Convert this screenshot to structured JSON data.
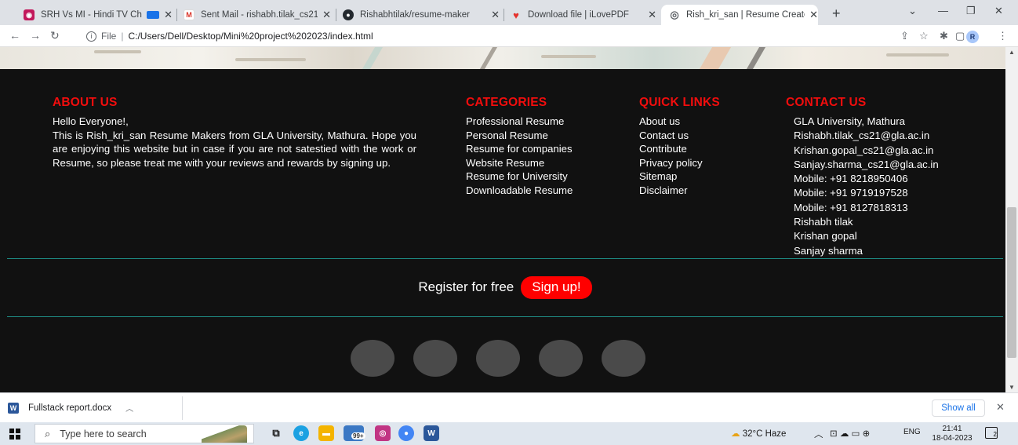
{
  "browser": {
    "tabs": [
      {
        "title": "SRH Vs MI - Hindi TV Ch",
        "favicon_color": "#c2185b",
        "favicon_glyph": "SR"
      },
      {
        "title": "Sent Mail - rishabh.tilak_cs21",
        "favicon_color": "#ffffff",
        "favicon_glyph": "M"
      },
      {
        "title": "Rishabhtilak/resume-maker",
        "favicon_color": "#24292f",
        "favicon_glyph": "GH"
      },
      {
        "title": "Download file | iLovePDF",
        "favicon_color": "#e5322d",
        "favicon_glyph": "♥"
      },
      {
        "title": "Rish_kri_san | Resume Creato",
        "favicon_color": "#5f6368",
        "favicon_glyph": "◎"
      }
    ],
    "active_tab": 4,
    "address": {
      "scheme_label": "File",
      "url": "C:/Users/Dell/Desktop/Mini%20project%202023/index.html"
    }
  },
  "page": {
    "about": {
      "heading": "ABOUT US",
      "greeting": "Hello Everyone!,",
      "body": "This is Rish_kri_san Resume Makers from GLA University, Mathura. Hope you are enjoying this website but in case if you are not satestied with the work or Resume, so please treat me with your reviews and rewards by signing up."
    },
    "categories": {
      "heading": "CATEGORIES",
      "items": [
        "Professional Resume",
        "Personal Resume",
        "Resume for companies",
        "Website Resume",
        "Resume for University",
        "Downloadable Resume"
      ]
    },
    "quick_links": {
      "heading": "QUICK LINKS",
      "items": [
        "About us",
        "Contact us",
        "Contribute",
        "Privacy policy",
        "Sitemap",
        "Disclaimer"
      ]
    },
    "contact": {
      "heading": "CONTACT US",
      "lines": [
        "GLA University, Mathura",
        "Rishabh.tilak_cs21@gla.ac.in",
        "Krishan.gopal_cs21@gla.ac.in",
        "Sanjay.sharma_cs21@gla.ac.in",
        "Mobile: +91 8218950406",
        "Mobile: +91 9719197528",
        "Mobile: +91 8127818313",
        "Rishabh tilak",
        "Krishan gopal",
        "Sanjay sharma"
      ]
    },
    "register": {
      "label": "Register for free",
      "button": "Sign up!"
    },
    "colors": {
      "heading": "#f20d0d",
      "background": "#111111",
      "divider": "#1e8a82",
      "button": "#ff0000"
    }
  },
  "download_shelf": {
    "file_name": "Fullstack report.docx",
    "show_all": "Show all"
  },
  "taskbar": {
    "search_placeholder": "Type here to search",
    "weather": "32°C  Haze",
    "language": "ENG",
    "time": "21:41",
    "date": "18-04-2023",
    "badge": "99+",
    "notif_count": "2"
  }
}
